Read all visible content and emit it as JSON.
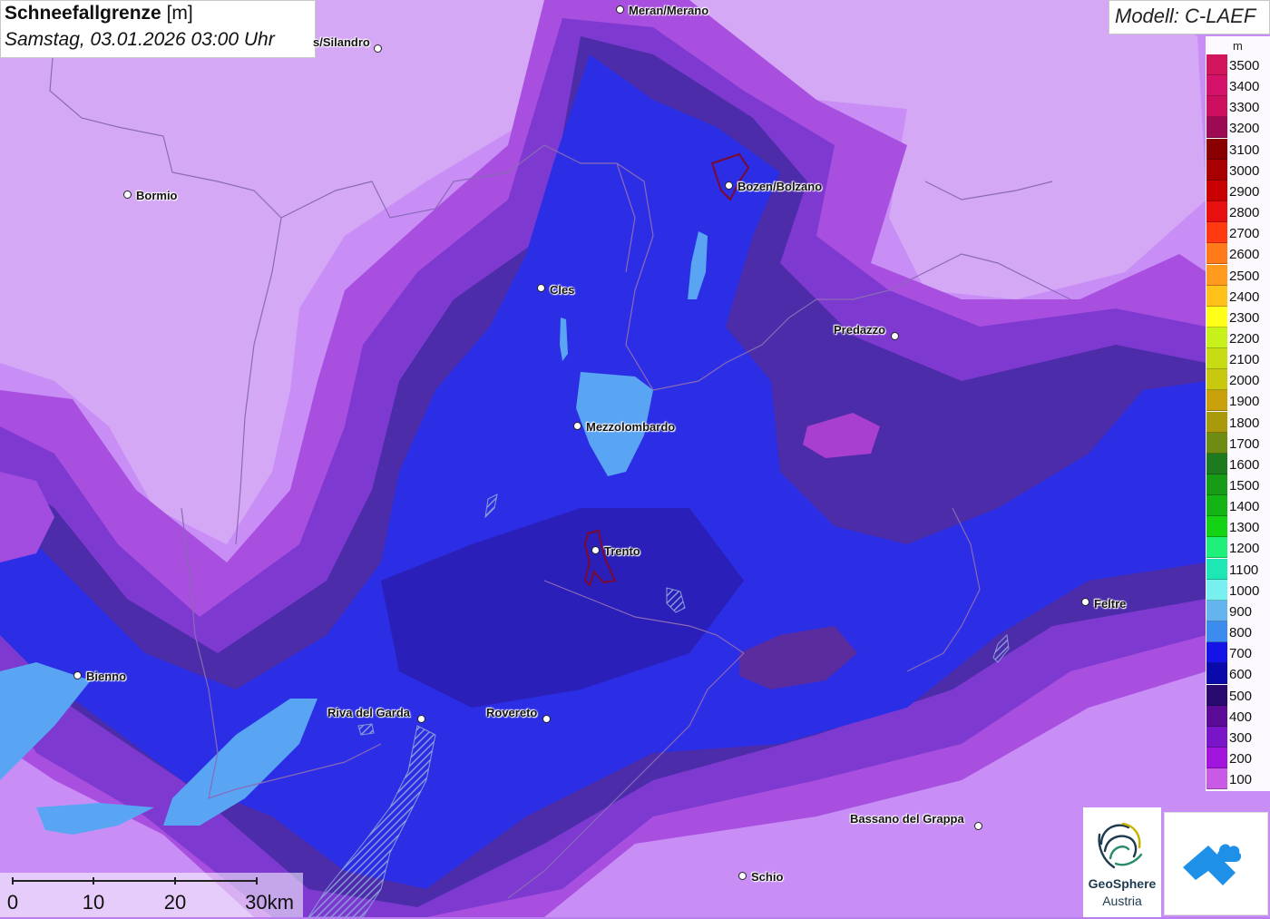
{
  "header": {
    "title_bold": "Schneefallgrenze",
    "title_unit": " [m]",
    "datetime": "Samstag, 03.01.2026 03:00 Uhr"
  },
  "model": {
    "label": "Modell: C-LAEF"
  },
  "legend": {
    "unit": "m",
    "entries": [
      {
        "label": "3500",
        "color": "#d1145c"
      },
      {
        "label": "3400",
        "color": "#d5126a"
      },
      {
        "label": "3300",
        "color": "#cc0e5e"
      },
      {
        "label": "3200",
        "color": "#9c0a54"
      },
      {
        "label": "3100",
        "color": "#8a0000"
      },
      {
        "label": "3000",
        "color": "#a80000"
      },
      {
        "label": "2900",
        "color": "#c80000"
      },
      {
        "label": "2800",
        "color": "#e80f0f"
      },
      {
        "label": "2700",
        "color": "#ff3a10"
      },
      {
        "label": "2600",
        "color": "#ff7a1a"
      },
      {
        "label": "2500",
        "color": "#ff9a1f"
      },
      {
        "label": "2400",
        "color": "#ffc21a"
      },
      {
        "label": "2300",
        "color": "#ffff1a"
      },
      {
        "label": "2200",
        "color": "#c8f01a"
      },
      {
        "label": "2100",
        "color": "#c8dc14"
      },
      {
        "label": "2000",
        "color": "#c8c80e"
      },
      {
        "label": "1900",
        "color": "#c8a00a"
      },
      {
        "label": "1800",
        "color": "#a89a0a"
      },
      {
        "label": "1700",
        "color": "#6e8c14"
      },
      {
        "label": "1600",
        "color": "#1e7a1e"
      },
      {
        "label": "1500",
        "color": "#169c16"
      },
      {
        "label": "1400",
        "color": "#14b414"
      },
      {
        "label": "1300",
        "color": "#14d214"
      },
      {
        "label": "1200",
        "color": "#1ef07a"
      },
      {
        "label": "1100",
        "color": "#1ee6b4"
      },
      {
        "label": "1000",
        "color": "#78f0f0"
      },
      {
        "label": "900",
        "color": "#64b4f0"
      },
      {
        "label": "800",
        "color": "#3c8cf0"
      },
      {
        "label": "700",
        "color": "#1414e6"
      },
      {
        "label": "600",
        "color": "#0a0aaa"
      },
      {
        "label": "500",
        "color": "#280a6e"
      },
      {
        "label": "400",
        "color": "#5a0a96"
      },
      {
        "label": "300",
        "color": "#7a14c8"
      },
      {
        "label": "200",
        "color": "#a014dc"
      },
      {
        "label": "100",
        "color": "#c85ae6"
      }
    ]
  },
  "scale": {
    "ticks": [
      "0",
      "10",
      "20",
      "30km"
    ]
  },
  "cities": [
    {
      "name": "Meran/Merano"
    },
    {
      "name": "s/Silandro"
    },
    {
      "name": "Bormio"
    },
    {
      "name": "Bozen/Bolzano"
    },
    {
      "name": "Cles"
    },
    {
      "name": "Predazzo"
    },
    {
      "name": "Mezzolombardo"
    },
    {
      "name": "Trento"
    },
    {
      "name": "Feltre"
    },
    {
      "name": "Bienno"
    },
    {
      "name": "Riva del Garda"
    },
    {
      "name": "Rovereto"
    },
    {
      "name": "Bassano del Grappa"
    },
    {
      "name": "Schio"
    }
  ],
  "logos": {
    "geosphere_name": "GeoSphere",
    "geosphere_sub": "Austria"
  }
}
